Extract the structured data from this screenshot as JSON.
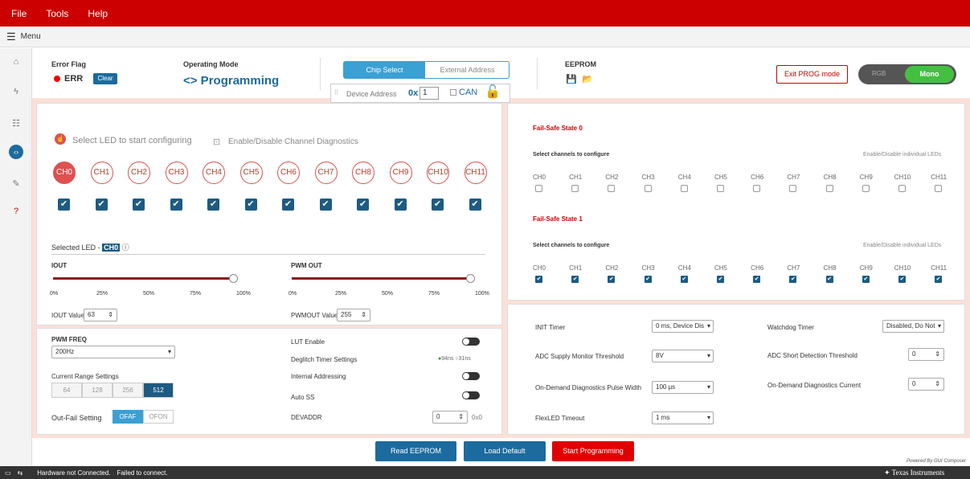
{
  "menu": {
    "file": "File",
    "tools": "Tools",
    "help": "Help"
  },
  "submenu": {
    "label": "Menu"
  },
  "top": {
    "error_flag_label": "Error Flag",
    "err_text": "ERR",
    "clear_btn": "Clear",
    "mode_label": "Operating Mode",
    "mode_value": "<> Programming",
    "tab_chip_select": "Chip Select",
    "tab_external": "External Address",
    "device_addr_label": "Device Address",
    "device_prefix": "0x",
    "device_value": "1",
    "can_label": "CAN",
    "eeprom_label": "EEPROM",
    "exit_prog": "Exit PROG mode",
    "toggle_rgb": "RGB",
    "toggle_mono": "Mono"
  },
  "leds": {
    "select_text": "Select LED to start configuring",
    "diag_text": "Enable/Disable Channel Diagnostics",
    "channels": [
      "CH0",
      "CH1",
      "CH2",
      "CH3",
      "CH4",
      "CH5",
      "CH6",
      "CH7",
      "CH8",
      "CH9",
      "CH10",
      "CH11"
    ]
  },
  "selected": {
    "label": "Selected LED",
    "sep": "-",
    "value": "CH0"
  },
  "iout": {
    "label": "IOUT",
    "ticks": [
      "0%",
      "25%",
      "50%",
      "75%",
      "100%"
    ],
    "value_label": "IOUT Value:",
    "value": "63",
    "level": 1.0
  },
  "pwmout": {
    "label": "PWM OUT",
    "ticks": [
      "0%",
      "25%",
      "50%",
      "75%",
      "100%"
    ],
    "value_label": "PWMOUT Value:",
    "value": "255",
    "level": 1.0
  },
  "pwmfreq": {
    "label": "PWM FREQ",
    "value": "200Hz"
  },
  "range": {
    "label": "Current Range Settings",
    "options": [
      "64",
      "128",
      "256",
      "512"
    ]
  },
  "outfail": {
    "label": "Out-Fail Setting",
    "opt1": "OFAF",
    "opt2": "OFON"
  },
  "settings": {
    "lut": "LUT Enable",
    "deglitch": "Deglitch Timer Settings",
    "deg1": "94ns",
    "deg2": "31ns",
    "internal": "Internal Addressing",
    "autoss": "Auto SS",
    "devaddr": "DEVADDR",
    "devaddr_value": "0",
    "devaddr_hex": "0x0"
  },
  "fs0": {
    "title": "Fail-Safe State 0",
    "sub": "Select channels to configure",
    "right": "Enable/Disable individual LEDs"
  },
  "fs1": {
    "title": "Fail-Safe State 1",
    "sub": "Select channels to configure",
    "right": "Enable/Disable individual LEDs"
  },
  "timers": {
    "init": "INIT Timer",
    "init_val": "0 ms, Device Dis",
    "wd": "Watchdog Timer",
    "wd_val": "Disabled, Do Not",
    "adcsm": "ADC Supply Monitor Threshold",
    "adcsm_val": "8V",
    "adcsd": "ADC Short Detection Threshold",
    "adcsd_val": "0",
    "odpw": "On-Demand Diagnostics Pulse Width",
    "odpw_val": "100 µs",
    "odc": "On-Demand Diagnostics Current",
    "odc_val": "0",
    "flex": "FlexLED Timeout",
    "flex_val": "1 ms"
  },
  "actions": {
    "read": "Read EEPROM",
    "load": "Load Default",
    "start": "Start Programming",
    "powered": "Powered By GUI Composer"
  },
  "footer": {
    "status": "Hardware not Connected.",
    "fail": "Failed to connect.",
    "brand": "Texas Instruments"
  },
  "colors": {
    "red": "#cc0000",
    "blue": "#1c6b9e",
    "teal": "#3ba0d4"
  }
}
